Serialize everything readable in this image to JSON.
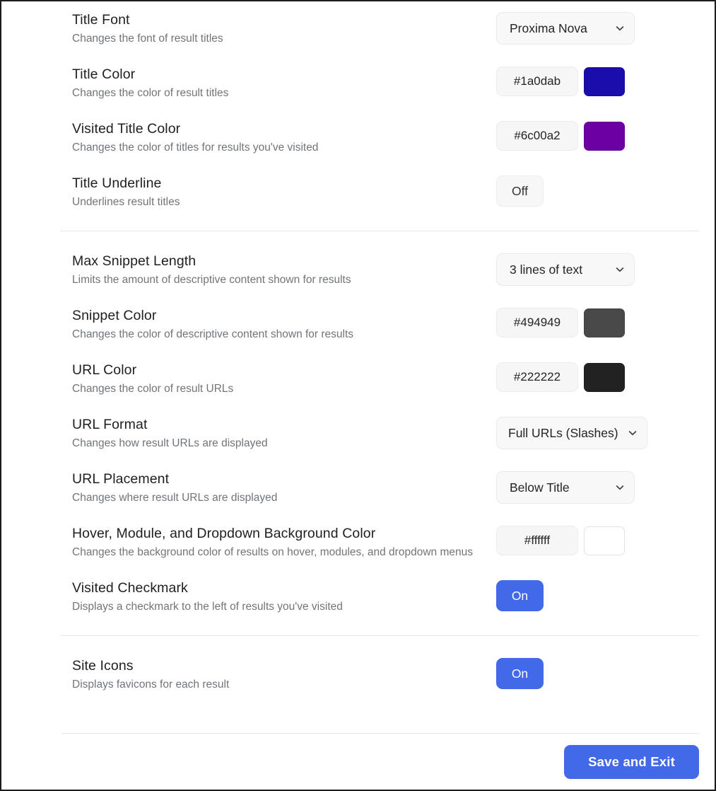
{
  "settings": {
    "groups": [
      {
        "name": "title-group",
        "rows": [
          {
            "title": "Title Font",
            "description": "Changes the font of result titles",
            "control": "dropdown",
            "value": "Proxima Nova"
          },
          {
            "title": "Title Color",
            "description": "Changes the color of result titles",
            "control": "color",
            "value": "#1a0dab",
            "swatch": "#1a0dab"
          },
          {
            "title": "Visited Title Color",
            "description": "Changes the color of titles for results you've visited",
            "control": "color",
            "value": "#6c00a2",
            "swatch": "#6c00a2"
          },
          {
            "title": "Title Underline",
            "description": "Underlines result titles",
            "control": "toggle",
            "value": "Off",
            "state": "off"
          }
        ]
      },
      {
        "name": "snippet-url-group",
        "rows": [
          {
            "title": "Max Snippet Length",
            "description": "Limits the amount of descriptive content shown for results",
            "control": "dropdown",
            "value": "3 lines of text"
          },
          {
            "title": "Snippet Color",
            "description": "Changes the color of descriptive content shown for results",
            "control": "color",
            "value": "#494949",
            "swatch": "#494949"
          },
          {
            "title": "URL Color",
            "description": "Changes the color of result URLs",
            "control": "color",
            "value": "#222222",
            "swatch": "#222222"
          },
          {
            "title": "URL Format",
            "description": "Changes how result URLs are displayed",
            "control": "dropdown-wide",
            "value": "Full URLs (Slashes)"
          },
          {
            "title": "URL Placement",
            "description": "Changes where result URLs are displayed",
            "control": "dropdown",
            "value": "Below Title"
          },
          {
            "title": "Hover, Module, and Dropdown Background Color",
            "description": "Changes the background color of results on hover, modules, and dropdown menus",
            "control": "color",
            "value": "#ffffff",
            "swatch": "#ffffff"
          },
          {
            "title": "Visited Checkmark",
            "description": "Displays a checkmark to the left of results you've visited",
            "control": "toggle",
            "value": "On",
            "state": "on"
          }
        ]
      },
      {
        "name": "site-icons-group",
        "rows": [
          {
            "title": "Site Icons",
            "description": "Displays favicons for each result",
            "control": "toggle",
            "value": "On",
            "state": "on"
          }
        ]
      }
    ]
  },
  "footer": {
    "save_label": "Save and Exit"
  },
  "icons": {
    "chevron": "chevron-down-icon"
  },
  "colors": {
    "accent": "#4169e8",
    "title_color": "#1a0dab",
    "visited_title_color": "#6c00a2",
    "snippet_color": "#494949",
    "url_color": "#222222",
    "background_color": "#ffffff"
  }
}
